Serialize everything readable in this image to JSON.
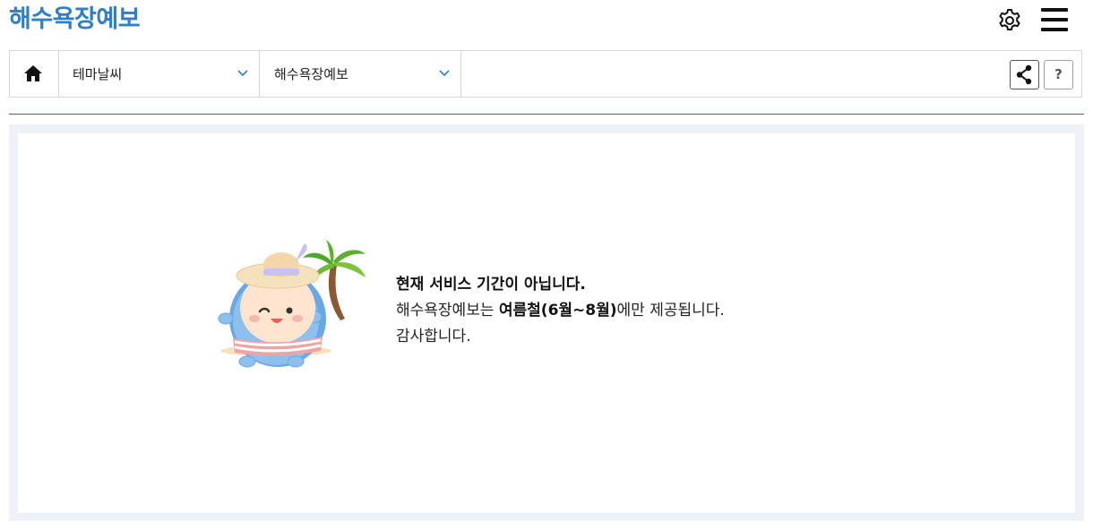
{
  "header": {
    "title": "해수욕장예보",
    "settings_icon": "gear-icon",
    "menu_icon": "hamburger-menu-icon"
  },
  "nav": {
    "home_icon": "home-icon",
    "dropdown1": "테마날씨",
    "dropdown2": "해수욕장예보",
    "share_icon": "share-icon",
    "help_label": "?"
  },
  "message": {
    "line1": "현재 서비스 기간이 아닙니다.",
    "line2_prefix": "해수욕장예보는 ",
    "line2_bold": "여름철(6월~8월)",
    "line2_suffix": "에만 제공됩니다.",
    "line3": "감사합니다."
  },
  "colors": {
    "title": "#2e7fc7",
    "divider": "#2a6f97",
    "content_bg": "#eef1f5",
    "chevron": "#2e7fc7"
  }
}
